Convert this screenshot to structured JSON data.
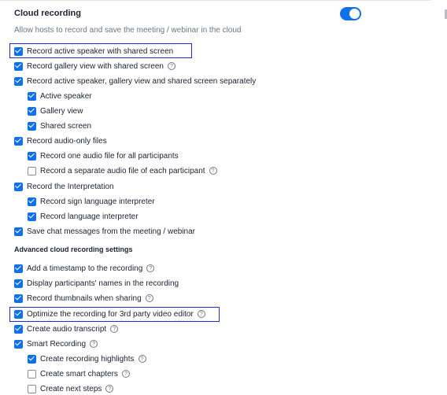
{
  "cloud_recording": {
    "title": "Cloud recording",
    "description": "Allow hosts to record and save the meeting / webinar in the cloud",
    "enabled": true
  },
  "options": [
    {
      "label": "Record active speaker with shared screen",
      "checked": true,
      "help": false
    },
    {
      "label": "Record gallery view with shared screen",
      "checked": true,
      "help": true
    },
    {
      "label": "Record active speaker, gallery view and shared screen separately",
      "checked": true,
      "help": false
    },
    {
      "label": "Active speaker",
      "checked": true,
      "help": false
    },
    {
      "label": "Gallery view",
      "checked": true,
      "help": false
    },
    {
      "label": "Shared screen",
      "checked": true,
      "help": false
    },
    {
      "label": "Record audio-only files",
      "checked": true,
      "help": false
    },
    {
      "label": "Record one audio file for all participants",
      "checked": true,
      "help": false
    },
    {
      "label": "Record a separate audio file of each participant",
      "checked": false,
      "help": true
    },
    {
      "label": "Record the Interpretation",
      "checked": true,
      "help": false
    },
    {
      "label": "Record sign language interpreter",
      "checked": true,
      "help": false
    },
    {
      "label": "Record language interpreter",
      "checked": true,
      "help": false
    },
    {
      "label": "Save chat messages from the meeting / webinar",
      "checked": true,
      "help": false
    }
  ],
  "advanced": {
    "heading": "Advanced cloud recording settings",
    "options": [
      {
        "label": "Add a timestamp to the recording",
        "checked": true,
        "help": true
      },
      {
        "label": "Display participants' names in the recording",
        "checked": true,
        "help": false
      },
      {
        "label": "Record thumbnails when sharing",
        "checked": true,
        "help": true
      },
      {
        "label": "Optimize the recording for 3rd party video editor",
        "checked": true,
        "help": true
      },
      {
        "label": "Create audio transcript",
        "checked": true,
        "help": true
      },
      {
        "label": "Smart Recording",
        "checked": true,
        "help": true
      },
      {
        "label": "Create recording highlights",
        "checked": true,
        "help": true
      },
      {
        "label": "Create smart chapters",
        "checked": false,
        "help": true
      },
      {
        "label": "Create next steps",
        "checked": false,
        "help": true
      }
    ]
  },
  "help_glyph": "?",
  "colors": {
    "accent": "#0e71eb",
    "highlight_box": "#1f2ccf",
    "text": "#232333",
    "muted": "#6e7680"
  }
}
